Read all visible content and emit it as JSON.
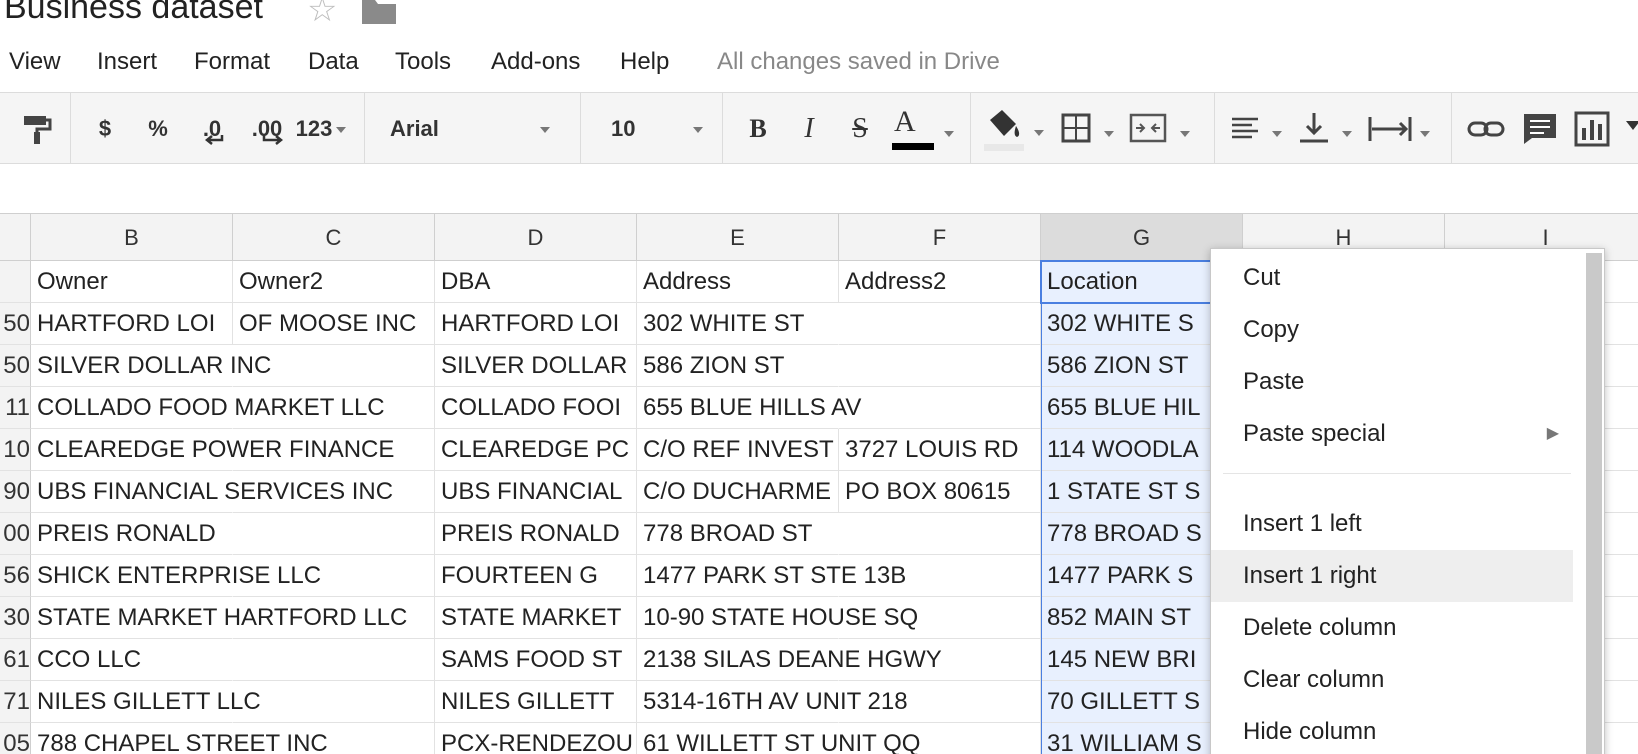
{
  "document": {
    "title": "Business dataset"
  },
  "menu": {
    "items": [
      "View",
      "Insert",
      "Format",
      "Data",
      "Tools",
      "Add-ons",
      "Help"
    ],
    "save_status": "All changes saved in Drive"
  },
  "toolbar": {
    "currency_label": "$",
    "percent_label": "%",
    "decrease_decimal_label": ".0",
    "increase_decimal_label": ".00",
    "number_format_label": "123",
    "font_family": "Arial",
    "font_size": "10",
    "bold_label": "B",
    "italic_label": "I",
    "strikethrough_label": "S",
    "text_color_label": "A",
    "text_color": "#000000"
  },
  "grid": {
    "column_headers": [
      "B",
      "C",
      "D",
      "E",
      "F",
      "G",
      "H",
      "I"
    ],
    "selected_column": "G",
    "header_row": [
      "Owner",
      "Owner2",
      "DBA",
      "Address",
      "Address2",
      "Location"
    ],
    "row_numbers": [
      "50",
      "50",
      "11",
      "10",
      "90",
      "00",
      "56",
      "30",
      "61",
      "71",
      "05"
    ],
    "rows": [
      [
        "HARTFORD LOI",
        "OF MOOSE  INC",
        "HARTFORD LOI",
        "302 WHITE ST",
        "",
        "302 WHITE S"
      ],
      [
        "SILVER DOLLAR INC",
        "",
        "SILVER DOLLAR",
        "586 ZION ST",
        "",
        "586 ZION ST"
      ],
      [
        "COLLADO FOOD MARKET LLC",
        "",
        "COLLADO FOOI",
        "655 BLUE HILLS AV",
        "",
        "655 BLUE HIL"
      ],
      [
        "CLEAREDGE POWER FINANCE",
        "",
        "CLEAREDGE PC",
        "C/O REF INVEST",
        "3727 LOUIS RD",
        "114 WOODLA"
      ],
      [
        "UBS FINANCIAL SERVICES INC",
        "",
        "UBS FINANCIAL",
        "C/O DUCHARME",
        "PO BOX 80615",
        "1 STATE ST S"
      ],
      [
        "PREIS RONALD",
        "",
        "PREIS RONALD",
        "778 BROAD ST",
        "",
        "778 BROAD S"
      ],
      [
        "SHICK ENTERPRISE LLC",
        "",
        "FOURTEEN G",
        "1477 PARK ST  STE 13B",
        "",
        "1477 PARK S"
      ],
      [
        "STATE MARKET HARTFORD LLC",
        "",
        "STATE MARKET",
        "10-90 STATE HOUSE SQ",
        "",
        "852 MAIN ST"
      ],
      [
        "CCO LLC",
        "",
        "SAMS FOOD ST",
        "2138 SILAS DEANE HGWY",
        "",
        "145 NEW BRI"
      ],
      [
        "NILES GILLETT LLC",
        "",
        "NILES GILLETT",
        "5314-16TH AV UNIT 218",
        "",
        "70 GILLETT S"
      ],
      [
        "788 CHAPEL STREET INC",
        "",
        "PCX-RENDEZOU",
        "61 WILLETT ST UNIT QQ",
        "",
        "31 WILLIAM S"
      ]
    ]
  },
  "context_menu": {
    "items": [
      {
        "label": "Cut"
      },
      {
        "label": "Copy"
      },
      {
        "label": "Paste"
      },
      {
        "label": "Paste special",
        "submenu": true
      },
      {
        "label": "Insert 1 left"
      },
      {
        "label": "Insert 1 right",
        "highlighted": true
      },
      {
        "label": "Delete column"
      },
      {
        "label": "Clear column"
      },
      {
        "label": "Hide column"
      }
    ]
  },
  "colors": {
    "selection": "#4a7fe0",
    "selection_fill": "#e8f0fe",
    "menu_highlight": "#eeeeee"
  }
}
